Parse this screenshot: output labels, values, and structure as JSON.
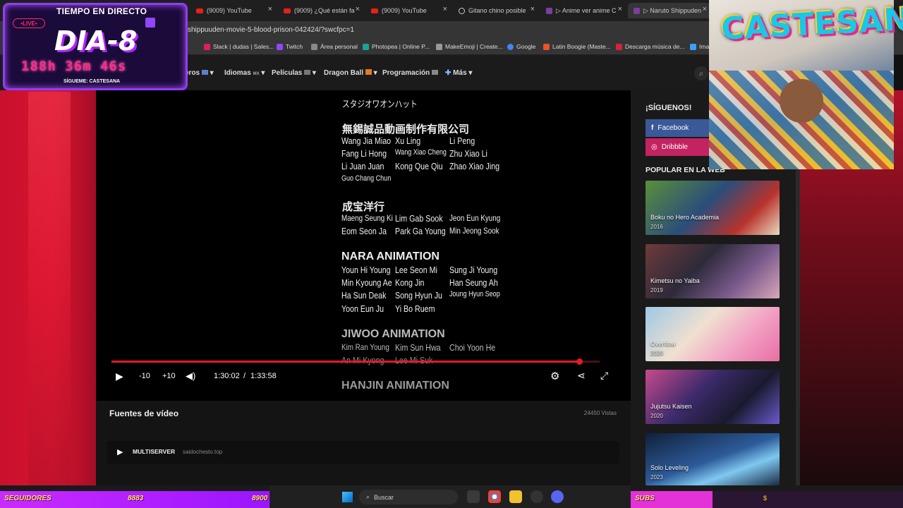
{
  "browser": {
    "tabs": [
      {
        "label": "(9009) YouTube",
        "icon": "youtube-icon"
      },
      {
        "label": "(9009) ¿Qué están fa",
        "icon": "youtube-icon"
      },
      {
        "label": "(9009) YouTube",
        "icon": "youtube-icon"
      },
      {
        "label": "Gitano chino posible",
        "icon": "globe-icon"
      },
      {
        "label": "▷ Anime ver anime C",
        "icon": "anime-site-icon"
      },
      {
        "label": "▷ Naruto Shippuden",
        "icon": "anime-site-icon"
      }
    ],
    "url": "shippuuden-movie-5-blood-prison-042424/?swcfpc=1",
    "bookmarks": [
      "Slack | dudas | Sales...",
      "Twitch",
      "Área personal",
      "Photopea | Online P...",
      "MakeEmoji | Create...",
      "Google",
      "Latin Boogie (Maste...",
      "Descarga música de...",
      "Ima"
    ],
    "bookmark_colors": [
      "#e01e5a",
      "#9146ff",
      "#888888",
      "#18a497",
      "#999999",
      "#4285f4",
      "#e8542a",
      "#d6223a",
      "#3aa0ff"
    ]
  },
  "site_nav": {
    "items": [
      {
        "label": "eros",
        "suffix": ""
      },
      {
        "label": "Idiomas",
        "suffix": "MX"
      },
      {
        "label": "Películas",
        "suffix": ""
      },
      {
        "label": "Dragon Ball",
        "suffix": ""
      },
      {
        "label": "Programación",
        "suffix": ""
      },
      {
        "label": "Más",
        "suffix": ""
      }
    ]
  },
  "video": {
    "credits": {
      "top_line": "スタジオワオンハット",
      "studio1": "無錫誠品動画制作有限公司",
      "studio1_names": [
        "Wang Jia Miao",
        "Xu Ling",
        "Li Peng",
        "Fang Li Hong",
        "Wang Xiao Cheng",
        "Zhu Xiao Li",
        "Li Juan Juan",
        "Kong Que Qiu",
        "Zhao Xiao Jing",
        "Guo Chang Chun"
      ],
      "studio2": "成宝洋行",
      "studio2_names": [
        "Maeng Seung Ki",
        "Lim Gab Sook",
        "Jeon Eun Kyung",
        "Eom Seon Ja",
        "Park Ga Young",
        "Min Jeong Sook"
      ],
      "studio3": "NARA ANIMATION",
      "studio3_names": [
        "Youn Hi Young",
        "Lee Seon Mi",
        "Sung Ji Young",
        "Min Kyoung Ae",
        "Kong Jin",
        "Han Seung Ah",
        "Ha Sun Deak",
        "Song Hyun Ju",
        "Joung Hyun Seop",
        "Yoon Eun Ju",
        "Yi Bo Ruem"
      ],
      "studio4": "JIWOO ANIMATION",
      "studio4_names": [
        "Kim Ran Young",
        "Kim Sun Hwa",
        "Choi Yoon He",
        "An Mi Kyong",
        "Lee Mi Suk"
      ],
      "studio5": "HANJIN ANIMATION"
    },
    "controls": {
      "rewind_label": "-10",
      "forward_label": "+10",
      "current_time": "1:30:02",
      "separator": "/",
      "duration": "1:33:58"
    },
    "progress_fraction": 0.958
  },
  "below_video": {
    "sources_title": "Fuentes de vídeo",
    "views": "24450 Vistas",
    "server_label": "MULTISERVER",
    "server_host": "saidochesto.top"
  },
  "sidebar": {
    "follow_title": "¡SÍGUENOS!",
    "social": [
      {
        "label": "Facebook",
        "color": "#3b5998"
      },
      {
        "label": "Dribbble",
        "color": "#c32361"
      }
    ],
    "popular_title": "POPULAR EN LA WEB",
    "cards": [
      {
        "title": "Boku no Hero Academia",
        "year": "2016"
      },
      {
        "title": "Kimetsu no Yaiba",
        "year": "2019"
      },
      {
        "title": "Overflow",
        "year": "2020"
      },
      {
        "title": "Jujutsu Kaisen",
        "year": "2020"
      },
      {
        "title": "Solo Leveling",
        "year": "2023"
      }
    ]
  },
  "stream_overlay": {
    "live_badge": "•LIVE•",
    "title": "TIEMPO EN DIRECTO",
    "day": "DIA-8",
    "timer": "188h 36m 46s",
    "follow": "SÍGUEME: CASTESANA",
    "webcam_logo": "CASTESANA"
  },
  "bottom_bars": {
    "followers_label": "SEGUIDORES",
    "followers_current": "8883",
    "followers_goal": "8900",
    "followers_fraction": 0.998,
    "subs_label": "SUBS",
    "subs_goal_marker": "$",
    "subs_fraction": 0.3
  },
  "taskbar": {
    "search_placeholder": "Buscar"
  },
  "colors": {
    "accent_red": "#e01b24",
    "overlay_purple": "#8f3df5",
    "timer_pink": "#ff2a8a"
  }
}
